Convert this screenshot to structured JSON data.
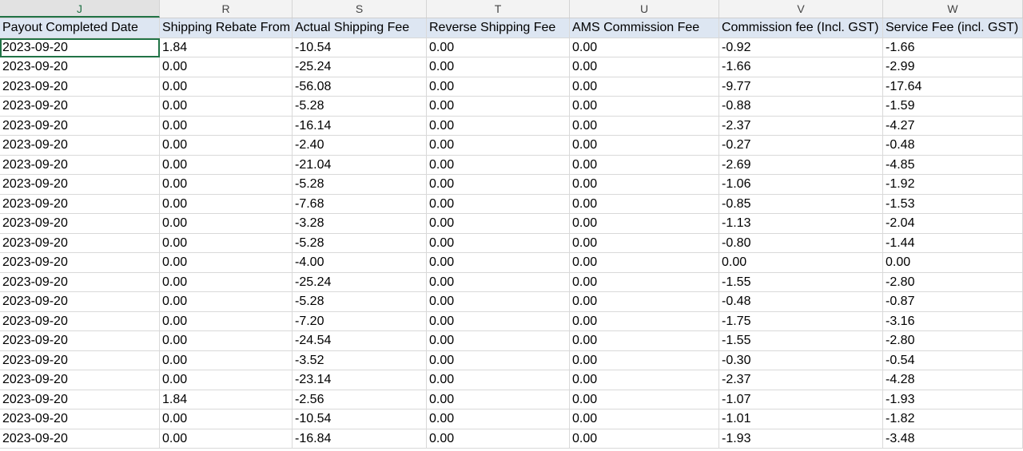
{
  "columns": [
    {
      "letter": "J",
      "header": "Payout Completed Date"
    },
    {
      "letter": "R",
      "header": "Shipping Rebate From"
    },
    {
      "letter": "S",
      "header": "Actual Shipping Fee"
    },
    {
      "letter": "T",
      "header": "Reverse Shipping Fee"
    },
    {
      "letter": "U",
      "header": "AMS Commission Fee"
    },
    {
      "letter": "V",
      "header": "Commission fee (Incl. GST)"
    },
    {
      "letter": "W",
      "header": "Service Fee (incl. GST)"
    }
  ],
  "rows": [
    [
      "2023-09-20",
      "1.84",
      "-10.54",
      "0.00",
      "0.00",
      "-0.92",
      "-1.66"
    ],
    [
      "2023-09-20",
      "0.00",
      "-25.24",
      "0.00",
      "0.00",
      "-1.66",
      "-2.99"
    ],
    [
      "2023-09-20",
      "0.00",
      "-56.08",
      "0.00",
      "0.00",
      "-9.77",
      "-17.64"
    ],
    [
      "2023-09-20",
      "0.00",
      "-5.28",
      "0.00",
      "0.00",
      "-0.88",
      "-1.59"
    ],
    [
      "2023-09-20",
      "0.00",
      "-16.14",
      "0.00",
      "0.00",
      "-2.37",
      "-4.27"
    ],
    [
      "2023-09-20",
      "0.00",
      "-2.40",
      "0.00",
      "0.00",
      "-0.27",
      "-0.48"
    ],
    [
      "2023-09-20",
      "0.00",
      "-21.04",
      "0.00",
      "0.00",
      "-2.69",
      "-4.85"
    ],
    [
      "2023-09-20",
      "0.00",
      "-5.28",
      "0.00",
      "0.00",
      "-1.06",
      "-1.92"
    ],
    [
      "2023-09-20",
      "0.00",
      "-7.68",
      "0.00",
      "0.00",
      "-0.85",
      "-1.53"
    ],
    [
      "2023-09-20",
      "0.00",
      "-3.28",
      "0.00",
      "0.00",
      "-1.13",
      "-2.04"
    ],
    [
      "2023-09-20",
      "0.00",
      "-5.28",
      "0.00",
      "0.00",
      "-0.80",
      "-1.44"
    ],
    [
      "2023-09-20",
      "0.00",
      "-4.00",
      "0.00",
      "0.00",
      "0.00",
      "0.00"
    ],
    [
      "2023-09-20",
      "0.00",
      "-25.24",
      "0.00",
      "0.00",
      "-1.55",
      "-2.80"
    ],
    [
      "2023-09-20",
      "0.00",
      "-5.28",
      "0.00",
      "0.00",
      "-0.48",
      "-0.87"
    ],
    [
      "2023-09-20",
      "0.00",
      "-7.20",
      "0.00",
      "0.00",
      "-1.75",
      "-3.16"
    ],
    [
      "2023-09-20",
      "0.00",
      "-24.54",
      "0.00",
      "0.00",
      "-1.55",
      "-2.80"
    ],
    [
      "2023-09-20",
      "0.00",
      "-3.52",
      "0.00",
      "0.00",
      "-0.30",
      "-0.54"
    ],
    [
      "2023-09-20",
      "0.00",
      "-23.14",
      "0.00",
      "0.00",
      "-2.37",
      "-4.28"
    ],
    [
      "2023-09-20",
      "1.84",
      "-2.56",
      "0.00",
      "0.00",
      "-1.07",
      "-1.93"
    ],
    [
      "2023-09-20",
      "0.00",
      "-10.54",
      "0.00",
      "0.00",
      "-1.01",
      "-1.82"
    ],
    [
      "2023-09-20",
      "0.00",
      "-16.84",
      "0.00",
      "0.00",
      "-1.93",
      "-3.48"
    ]
  ],
  "selected_cell": {
    "row": 0,
    "col": 0
  },
  "colors": {
    "accent": "#217346",
    "header_fill": "#dde6f2",
    "gridline": "#d9d9d9"
  }
}
